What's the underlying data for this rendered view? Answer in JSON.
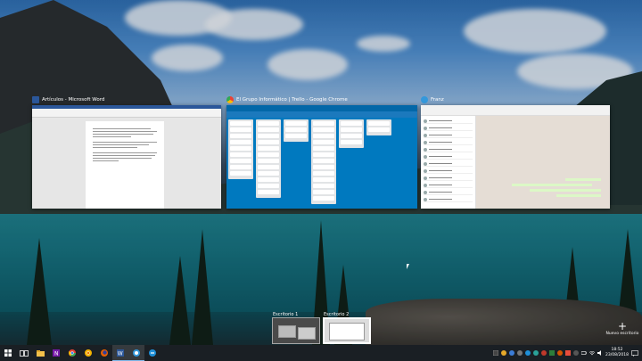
{
  "windows": [
    {
      "title": "Artículos - Microsoft Word",
      "icon": "word-icon",
      "color": "#2b579a"
    },
    {
      "title": "El Grupo Informático | Trello - Google Chrome",
      "icon": "chrome-icon",
      "color": "#ea4335"
    },
    {
      "title": "Franz",
      "icon": "franz-icon",
      "color": "#3498db"
    }
  ],
  "desktops": [
    {
      "label": "Escritorio 1",
      "active": false
    },
    {
      "label": "Escritorio 2",
      "active": true
    }
  ],
  "new_desktop_label": "Nuevo escritorio",
  "taskbar": {
    "icons": [
      "windows-start-icon",
      "task-view-icon",
      "file-explorer-icon",
      "onenote-icon",
      "chrome-icon",
      "chrome-canary-icon",
      "firefox-icon",
      "word-icon",
      "franz-icon",
      "edge-icon"
    ]
  },
  "clock": {
    "time": "18:52",
    "date": "23/08/2018"
  },
  "colors": {
    "taskbar": "#1a1f24",
    "trello": "#0079bf",
    "word": "#2b579a"
  }
}
